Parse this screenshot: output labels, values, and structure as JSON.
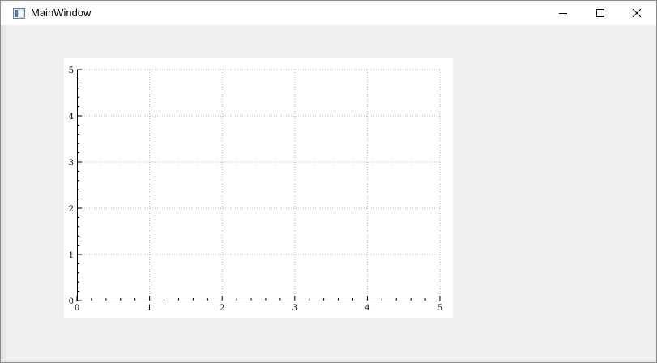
{
  "window": {
    "title": "MainWindow",
    "icon": "app-window-icon",
    "controls": {
      "minimize": "minimize-icon",
      "maximize": "maximize-icon",
      "close": "close-icon"
    }
  },
  "chart_data": {
    "type": "line",
    "series": [],
    "xlim": [
      0,
      5
    ],
    "ylim": [
      0,
      5
    ],
    "x_ticks": [
      "0",
      "1",
      "2",
      "3",
      "4",
      "5"
    ],
    "y_ticks": [
      "0",
      "1",
      "2",
      "3",
      "4",
      "5"
    ],
    "grid": true,
    "grid_style": "dotted",
    "minor_ticks_per_major": 5
  }
}
